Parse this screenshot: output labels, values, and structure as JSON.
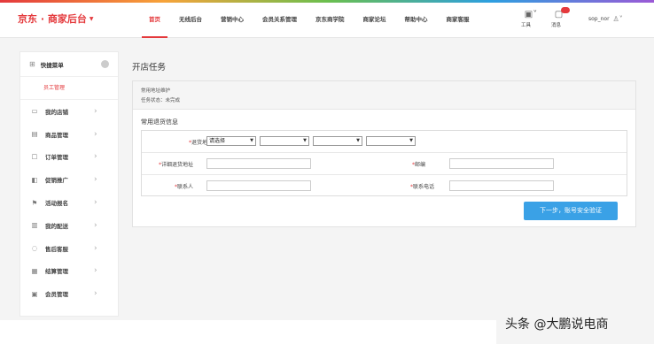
{
  "brand": {
    "title": "京东 · 商家后台"
  },
  "nav": [
    "首页",
    "无线后台",
    "营销中心",
    "会员关系管理",
    "京东商学院",
    "商家论坛",
    "帮助中心",
    "商家客服"
  ],
  "header_tools": {
    "tools_label": "工具",
    "messages_label": "消息"
  },
  "user": {
    "name": "sop_nor"
  },
  "sidebar": {
    "quick_menu": "快捷菜单",
    "sub_item": "员工管理",
    "items": [
      {
        "label": "我的店铺",
        "icon": "store-icon"
      },
      {
        "label": "商品管理",
        "icon": "goods-icon"
      },
      {
        "label": "订单管理",
        "icon": "order-icon"
      },
      {
        "label": "促销推广",
        "icon": "promotion-icon"
      },
      {
        "label": "活动报名",
        "icon": "activity-icon"
      },
      {
        "label": "我的配送",
        "icon": "delivery-icon"
      },
      {
        "label": "售后客服",
        "icon": "aftersale-icon"
      },
      {
        "label": "结算管理",
        "icon": "settlement-icon"
      },
      {
        "label": "会员管理",
        "icon": "member-icon"
      }
    ]
  },
  "main": {
    "page_title": "开店任务",
    "task_name": "常用地址维护",
    "task_status": "任务状态：未完成",
    "section_title": "常用退货信息",
    "form": {
      "address_label": "退货地址",
      "province_select": "请选择",
      "detail_address_label": "详细退货地址",
      "zip_label": "邮编",
      "contact_label": "联系人",
      "phone_label": "联系电话"
    },
    "next_button": "下一步，账号安全验证"
  },
  "watermark": "头条 @大鹏说电商"
}
